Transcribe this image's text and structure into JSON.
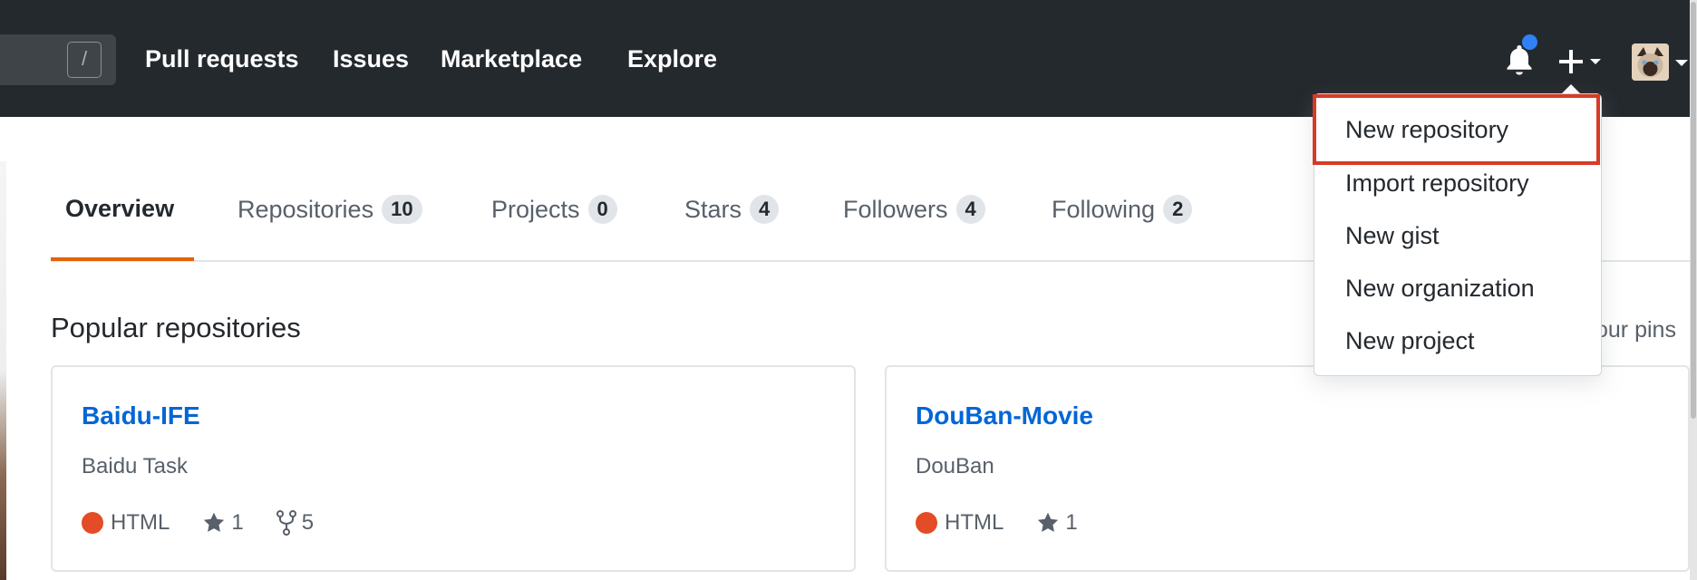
{
  "header": {
    "search_slash": "/",
    "nav": [
      "Pull requests",
      "Issues",
      "Marketplace",
      "Explore"
    ],
    "notification_color": "#2f81f7"
  },
  "tabs": [
    {
      "label": "Overview"
    },
    {
      "label": "Repositories",
      "count": "10"
    },
    {
      "label": "Projects",
      "count": "0"
    },
    {
      "label": "Stars",
      "count": "4"
    },
    {
      "label": "Followers",
      "count": "4"
    },
    {
      "label": "Following",
      "count": "2"
    }
  ],
  "section": {
    "title": "Popular repositories",
    "customize_label": "our pins"
  },
  "repos": [
    {
      "name": "Baidu-IFE",
      "description": "Baidu Task",
      "language": "HTML",
      "stars": "1",
      "forks": "5"
    },
    {
      "name": "DouBan-Movie",
      "description": "DouBan",
      "language": "HTML",
      "stars": "1"
    }
  ],
  "dropdown": {
    "items": [
      "New repository",
      "Import repository",
      "New gist",
      "New organization",
      "New project"
    ],
    "highlighted": "New repository"
  },
  "colors": {
    "header_bg": "#24292e",
    "tab_underline": "#e36209",
    "link": "#0366d6",
    "html_lang": "#e34c26",
    "highlight": "#d73a25"
  },
  "icons": {
    "notification": "bell-icon",
    "create": "plus-icon",
    "star": "star-icon",
    "fork": "fork-icon"
  }
}
